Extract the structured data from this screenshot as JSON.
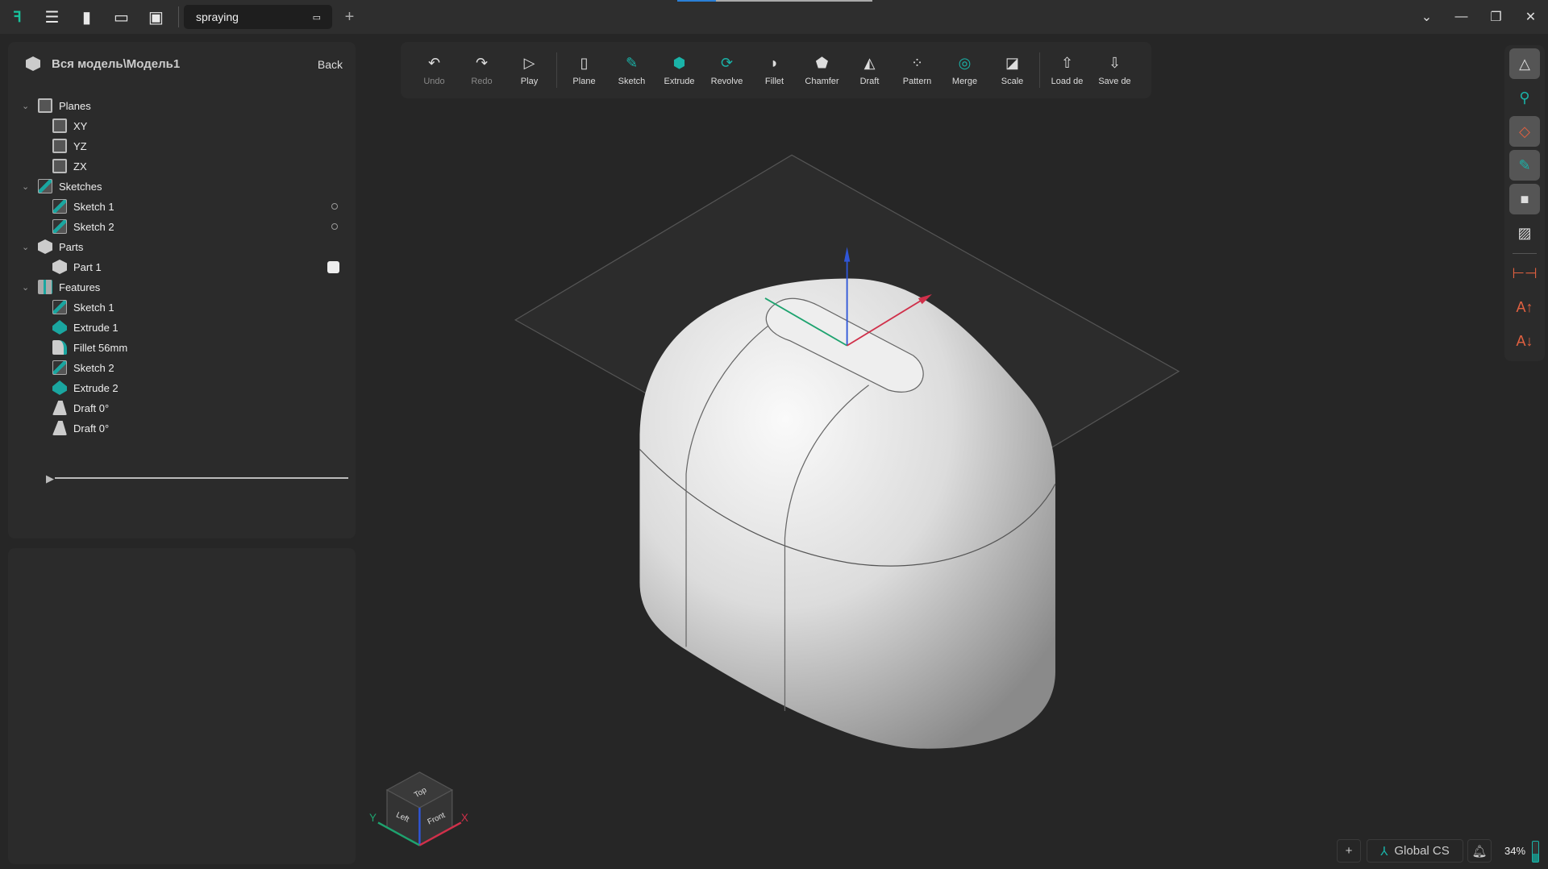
{
  "titlebar": {
    "tab_name": "spraying",
    "menu_icon": "hamburger-icon",
    "new_icon": "file-icon",
    "open_icon": "folder-icon",
    "save_icon": "save-icon"
  },
  "tree": {
    "title": "Вся модель\\Модель1",
    "back": "Back",
    "items": [
      {
        "label": "Planes",
        "level": 0,
        "icon": "plane"
      },
      {
        "label": "XY",
        "level": 1,
        "icon": "plane"
      },
      {
        "label": "YZ",
        "level": 1,
        "icon": "plane"
      },
      {
        "label": "ZX",
        "level": 1,
        "icon": "plane"
      },
      {
        "label": "Sketches",
        "level": 0,
        "icon": "sketch"
      },
      {
        "label": "Sketch 1",
        "level": 1,
        "icon": "sketch"
      },
      {
        "label": "Sketch 2",
        "level": 1,
        "icon": "sketch"
      },
      {
        "label": "Parts",
        "level": 0,
        "icon": "part"
      },
      {
        "label": "Part 1",
        "level": 1,
        "icon": "part"
      },
      {
        "label": "Features",
        "level": 0,
        "icon": "feat"
      },
      {
        "label": "Sketch 1",
        "level": 1,
        "icon": "sketch"
      },
      {
        "label": "Extrude 1",
        "level": 1,
        "icon": "extr"
      },
      {
        "label": "Fillet 56mm",
        "level": 1,
        "icon": "fillet"
      },
      {
        "label": "Sketch 2",
        "level": 1,
        "icon": "sketch"
      },
      {
        "label": "Extrude 2",
        "level": 1,
        "icon": "extr"
      },
      {
        "label": "Draft 0°",
        "level": 1,
        "icon": "draft"
      },
      {
        "label": "Draft 0°",
        "level": 1,
        "icon": "draft"
      }
    ]
  },
  "toolbar": {
    "undo": "Undo",
    "redo": "Redo",
    "play": "Play",
    "plane": "Plane",
    "sketch": "Sketch",
    "extrude": "Extrude",
    "revolve": "Revolve",
    "fillet": "Fillet",
    "chamfer": "Chamfer",
    "draft": "Draft",
    "pattern": "Pattern",
    "merge": "Merge",
    "scale": "Scale",
    "load": "Load de",
    "save": "Save de"
  },
  "viewcube": {
    "top": "Top",
    "left": "Left",
    "front": "Front",
    "x": "X",
    "y": "Y"
  },
  "status": {
    "cs": "Global CS",
    "zoom": "34%"
  },
  "colors": {
    "accent": "#1ab3a8",
    "x_axis": "#d0304a",
    "y_axis": "#1ea36f",
    "z_axis": "#2f56d8"
  }
}
